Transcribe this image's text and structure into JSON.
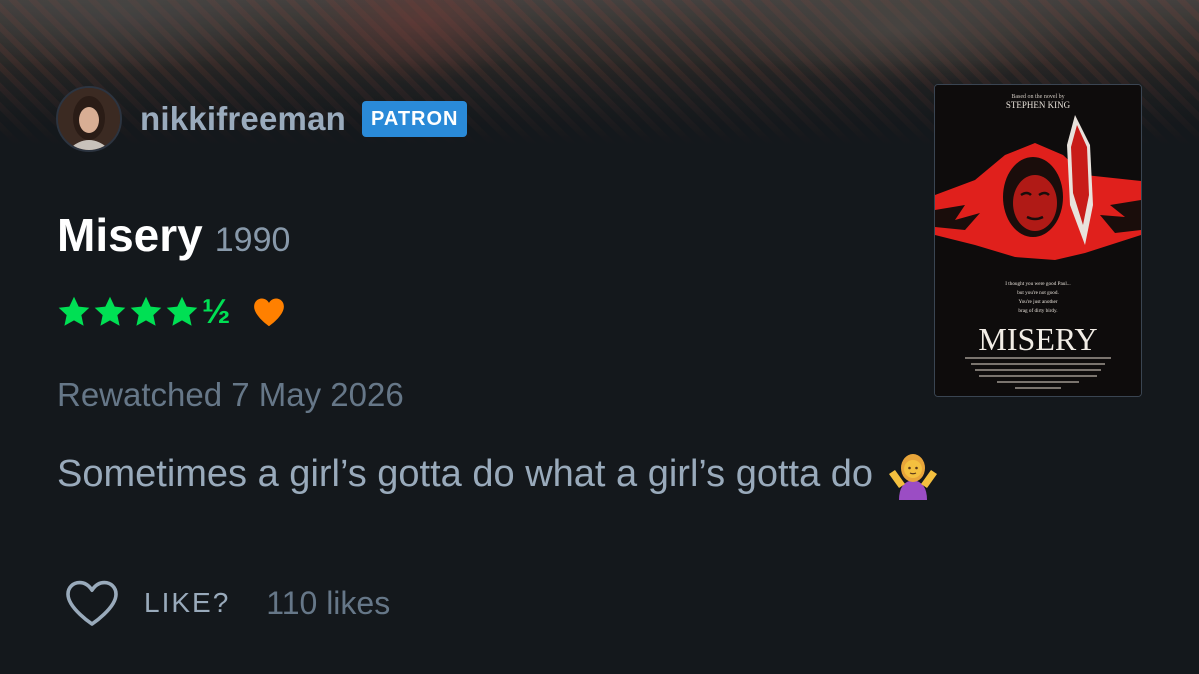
{
  "review": {
    "author": {
      "username": "nikkifreeman",
      "badge": "PATRON"
    },
    "film": {
      "title": "Misery",
      "year": "1990"
    },
    "rating": {
      "stars": 4.5,
      "half_glyph": "½",
      "liked": true
    },
    "watched_text": "Rewatched 7 May 2026",
    "body": "Sometimes a girl’s gotta do what a girl’s gotta do",
    "emoji": "person-shrugging-emoji",
    "actions": {
      "like_label": "LIKE?",
      "likes_count": "110 likes"
    },
    "poster": {
      "top_line": "Based on the novel by",
      "author": "STEPHEN KING",
      "tagline": [
        "I thought you were good Paul...",
        "but you're not good.",
        "You're just another",
        "brag of dirty birdy."
      ],
      "title": "MISERY"
    }
  },
  "colors": {
    "background": "#14181c",
    "star_green": "#00e054",
    "heart_orange": "#ff8000",
    "badge_blue": "#2a8ad8",
    "text_muted": "#678",
    "text_secondary": "#9ab"
  }
}
